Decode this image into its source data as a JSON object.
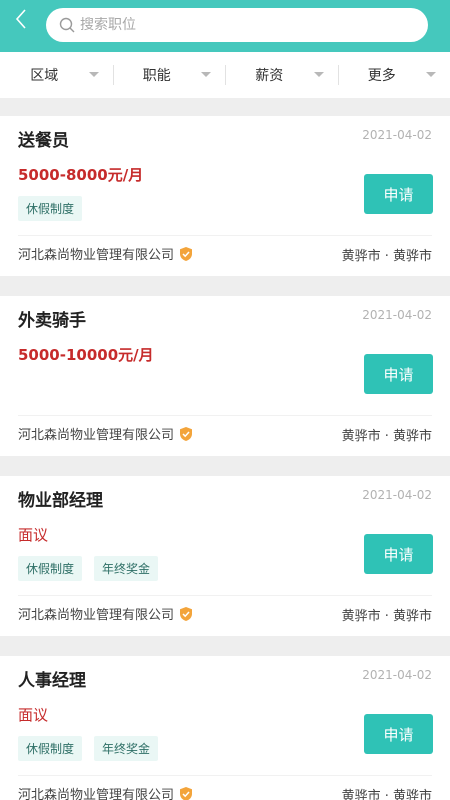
{
  "search": {
    "placeholder": "搜索职位"
  },
  "filters": [
    {
      "label": "区域"
    },
    {
      "label": "职能"
    },
    {
      "label": "薪资"
    },
    {
      "label": "更多"
    }
  ],
  "apply_label": "申请",
  "jobs": [
    {
      "title": "送餐员",
      "date": "2021-04-02",
      "salary": "5000-8000元/月",
      "tags": [
        "休假制度"
      ],
      "company": "河北森尚物业管理有限公司",
      "location": "黄骅市 · 黄骅市"
    },
    {
      "title": "外卖骑手",
      "date": "2021-04-02",
      "salary": "5000-10000元/月",
      "tags": [],
      "company": "河北森尚物业管理有限公司",
      "location": "黄骅市 · 黄骅市"
    },
    {
      "title": "物业部经理",
      "date": "2021-04-02",
      "salary": "面议",
      "tags": [
        "休假制度",
        "年终奖金"
      ],
      "company": "河北森尚物业管理有限公司",
      "location": "黄骅市 · 黄骅市"
    },
    {
      "title": "人事经理",
      "date": "2021-04-02",
      "salary": "面议",
      "tags": [
        "休假制度",
        "年终奖金"
      ],
      "company": "河北森尚物业管理有限公司",
      "location": "黄骅市 · 黄骅市"
    }
  ],
  "colors": {
    "header": "#45c8bd",
    "accent": "#2fc2b6",
    "salary": "#c62b2b",
    "verified": "#f3a43b"
  }
}
